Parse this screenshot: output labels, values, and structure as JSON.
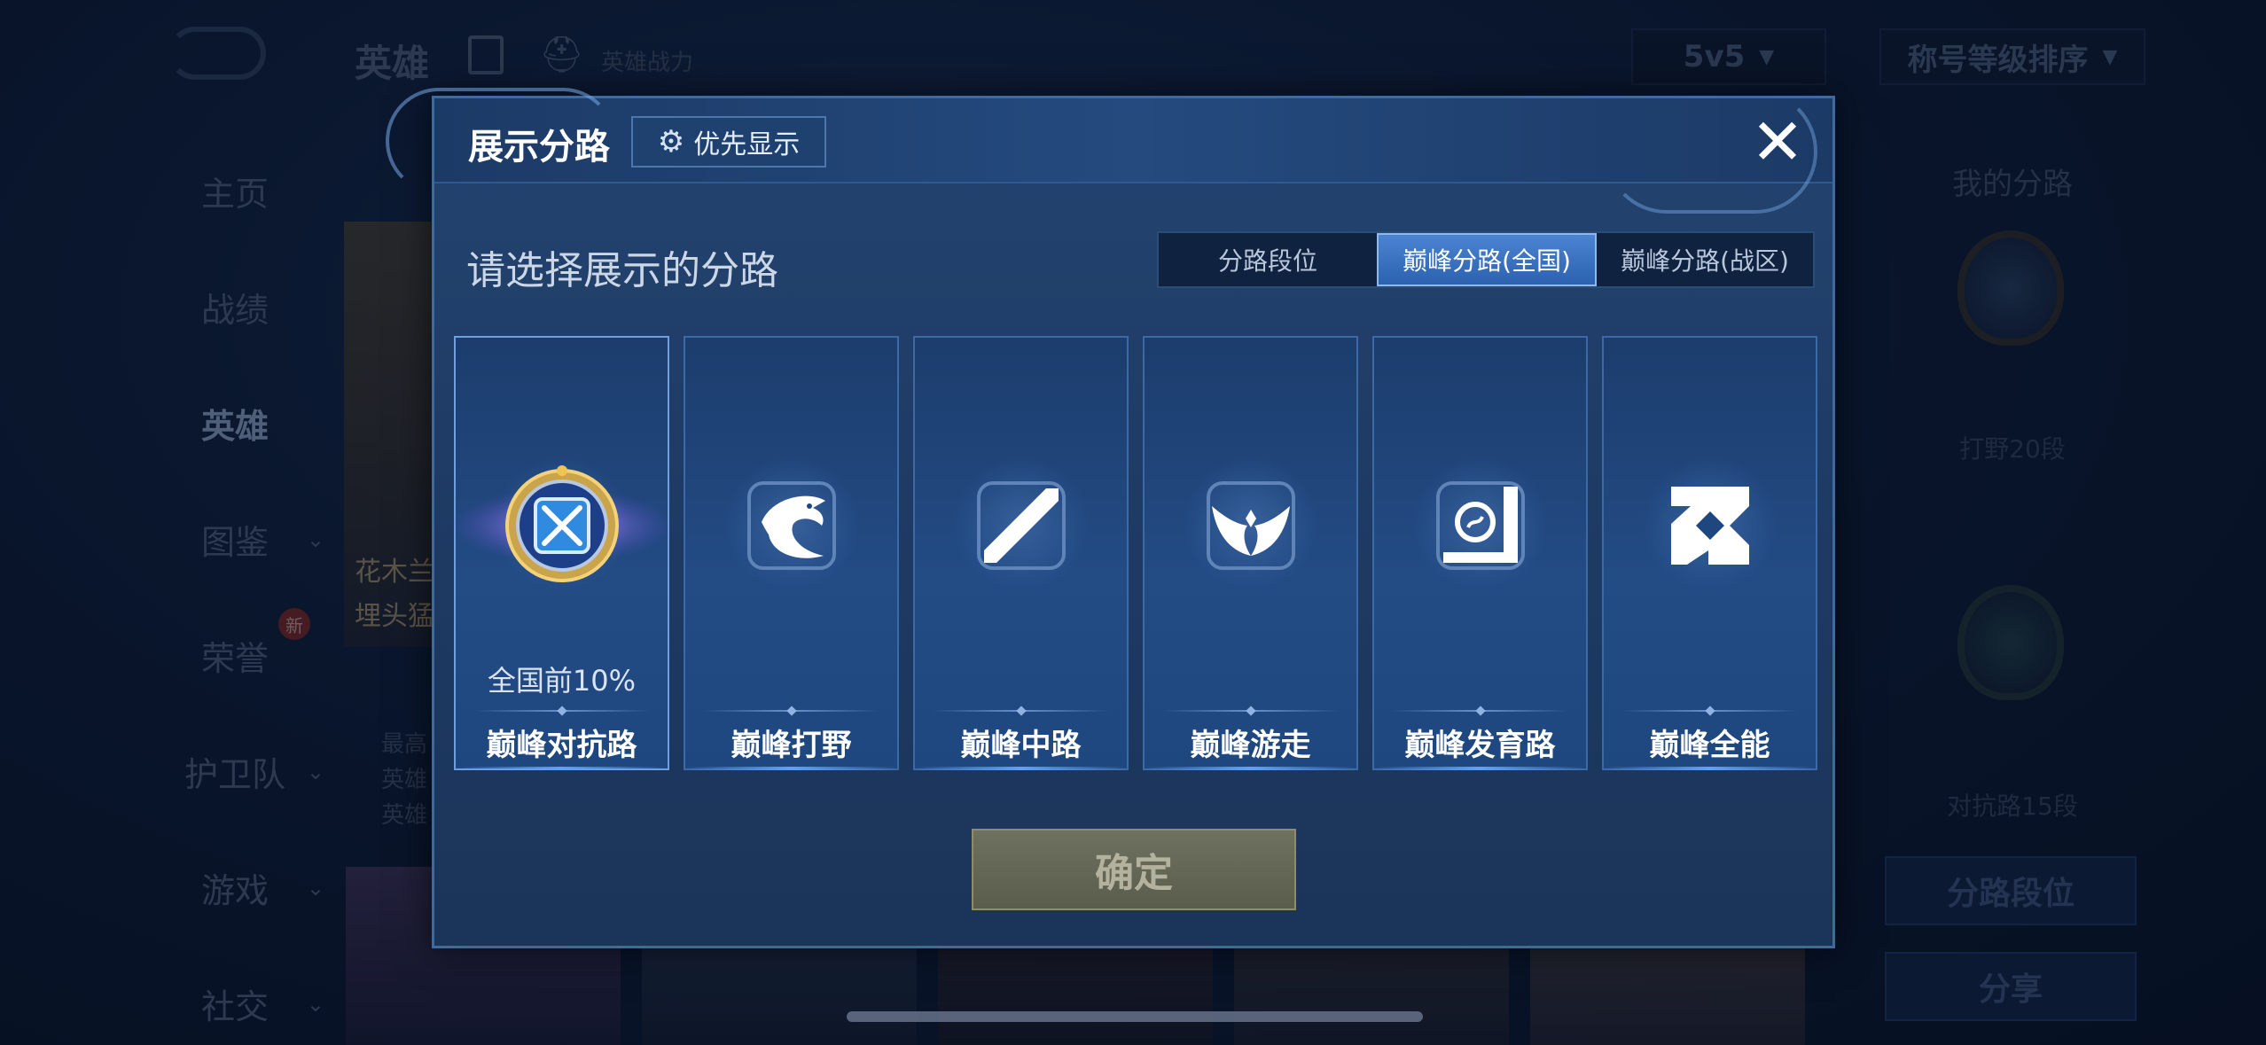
{
  "background": {
    "title": "英雄",
    "power_label": "英雄战力",
    "mode_value": "5v5",
    "sort_value": "称号等级排序",
    "sidebar": [
      {
        "label": "主页"
      },
      {
        "label": "战绩"
      },
      {
        "label": "英雄"
      },
      {
        "label": "图鉴"
      },
      {
        "label": "荣誉",
        "badge": "新"
      },
      {
        "label": "护卫队"
      },
      {
        "label": "游戏"
      },
      {
        "label": "社交"
      }
    ],
    "hero_card": {
      "name": "花木兰",
      "sub": "埋头猛"
    },
    "hero_meta": [
      "最高",
      "英雄",
      "英雄"
    ],
    "my_lanes_title": "我的分路",
    "rank1_text": "打野20段",
    "rank2_text": "对抗路15段",
    "lane_rank_button": "分路段位",
    "share_button": "分享"
  },
  "modal": {
    "title": "展示分路",
    "priority_label": "优先显示",
    "close_symbol": "✕",
    "prompt": "请选择展示的分路",
    "tabs": [
      {
        "label": "分路段位",
        "active": false
      },
      {
        "label": "巅峰分路(全国)",
        "active": true
      },
      {
        "label": "巅峰分路(战区)",
        "active": false
      }
    ],
    "lanes": [
      {
        "label": "巅峰对抗路",
        "rank": "全国前10%",
        "icon": "crossed-swords-medal-icon",
        "selected": true
      },
      {
        "label": "巅峰打野",
        "rank": "",
        "icon": "dragon-icon",
        "selected": false
      },
      {
        "label": "巅峰中路",
        "rank": "",
        "icon": "slash-staff-icon",
        "selected": false
      },
      {
        "label": "巅峰游走",
        "rank": "",
        "icon": "wings-icon",
        "selected": false
      },
      {
        "label": "巅峰发育路",
        "rank": "",
        "icon": "bow-target-icon",
        "selected": false
      },
      {
        "label": "巅峰全能",
        "rank": "",
        "icon": "diamond-slashes-icon",
        "selected": false
      }
    ],
    "confirm_label": "确定"
  },
  "colors": {
    "modal_bg": "#234470",
    "tab_active": "#4b84d2",
    "confirm_disabled": "#6f7160"
  }
}
